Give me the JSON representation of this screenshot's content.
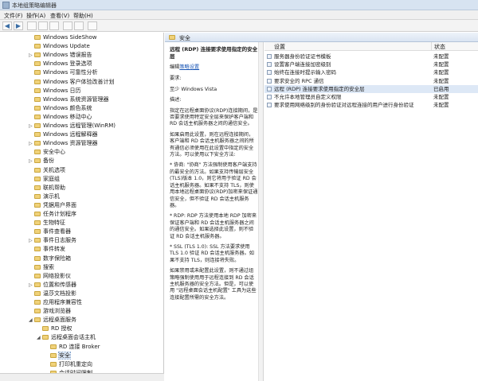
{
  "window": {
    "title": "本地组策略编辑器"
  },
  "menu": [
    "文件(F)",
    "操作(A)",
    "查看(V)",
    "帮助(H)"
  ],
  "toolbar": {
    "back_glyph": "◀",
    "forward_glyph": "▶",
    "buttons": [
      "folder-up-icon",
      "show-hide-tree-icon",
      "export-icon",
      "help-icon",
      "properties-icon",
      "filter-icon"
    ]
  },
  "tree": {
    "items": [
      {
        "label": "Windows SideShow",
        "indent": 3,
        "icon": "folder"
      },
      {
        "label": "Windows Update",
        "indent": 3,
        "icon": "folder"
      },
      {
        "label": "Windows 错误报告",
        "indent": 3,
        "icon": "folder",
        "expander": "▷"
      },
      {
        "label": "Windows 登录选项",
        "indent": 3,
        "icon": "folder"
      },
      {
        "label": "Windows 可靠性分析",
        "indent": 3,
        "icon": "folder"
      },
      {
        "label": "Windows 客户体验改善计划",
        "indent": 3,
        "icon": "folder"
      },
      {
        "label": "Windows 日历",
        "indent": 3,
        "icon": "folder"
      },
      {
        "label": "Windows 系统资源管理器",
        "indent": 3,
        "icon": "folder"
      },
      {
        "label": "Windows 颜色系统",
        "indent": 3,
        "icon": "folder"
      },
      {
        "label": "Windows 移动中心",
        "indent": 3,
        "icon": "folder"
      },
      {
        "label": "Windows 远程管理(WinRM)",
        "indent": 3,
        "icon": "folder",
        "expander": "▷"
      },
      {
        "label": "Windows 远程解释器",
        "indent": 3,
        "icon": "folder"
      },
      {
        "label": "Windows 资源管理器",
        "indent": 3,
        "icon": "folder",
        "expander": "▷"
      },
      {
        "label": "安全中心",
        "indent": 3,
        "icon": "folder"
      },
      {
        "label": "备份",
        "indent": 3,
        "icon": "folder",
        "expander": "▷"
      },
      {
        "label": "关机选项",
        "indent": 3,
        "icon": "folder"
      },
      {
        "label": "家庭组",
        "indent": 3,
        "icon": "folder"
      },
      {
        "label": "联机帮助",
        "indent": 3,
        "icon": "folder"
      },
      {
        "label": "演示机",
        "indent": 3,
        "icon": "folder"
      },
      {
        "label": "凭据用户界面",
        "indent": 3,
        "icon": "folder"
      },
      {
        "label": "任务计划程序",
        "indent": 3,
        "icon": "folder"
      },
      {
        "label": "生物特征",
        "indent": 3,
        "icon": "folder"
      },
      {
        "label": "事件查看器",
        "indent": 3,
        "icon": "folder"
      },
      {
        "label": "事件日志服务",
        "indent": 3,
        "icon": "folder",
        "expander": "▷"
      },
      {
        "label": "事件转发",
        "indent": 3,
        "icon": "folder"
      },
      {
        "label": "数字保险箱",
        "indent": 3,
        "icon": "folder"
      },
      {
        "label": "搜索",
        "indent": 3,
        "icon": "folder"
      },
      {
        "label": "网络投影仪",
        "indent": 3,
        "icon": "folder"
      },
      {
        "label": "位置和传感器",
        "indent": 3,
        "icon": "folder",
        "expander": "▷"
      },
      {
        "label": "温莎文档投影",
        "indent": 3,
        "icon": "folder"
      },
      {
        "label": "应用程序兼容性",
        "indent": 3,
        "icon": "folder"
      },
      {
        "label": "游戏浏览器",
        "indent": 3,
        "icon": "folder"
      },
      {
        "label": "远程桌面服务",
        "indent": 3,
        "icon": "folder",
        "expander": "◢"
      },
      {
        "label": "RD 授权",
        "indent": 4,
        "icon": "folder"
      },
      {
        "label": "远程桌面会话主机",
        "indent": 4,
        "icon": "folder",
        "expander": "◢"
      },
      {
        "label": "RD 连接 Broker",
        "indent": 5,
        "icon": "folder"
      },
      {
        "label": "安全",
        "indent": 5,
        "icon": "folder",
        "selected": true
      },
      {
        "label": "打印机重定向",
        "indent": 5,
        "icon": "folder"
      },
      {
        "label": "会话时间限制",
        "indent": 5,
        "icon": "folder"
      }
    ]
  },
  "content": {
    "breadcrumb": "安全",
    "policy_title": "远程 (RDP) 连接要求使用指定的安全层",
    "edit_prefix": "编辑",
    "edit_link": "策略设置",
    "requirement_label": "要求:",
    "requirement_value": "至少 Windows Vista",
    "description_label": "描述:",
    "description": [
      "指定在远程桌面协议(RDP)连接期间，是否要求使用特定安全层来保护客户端和 RD 会话主机服务器之间的通信安全。",
      "如果启用此设置，则在远程连接期间，客户端和 RD 会话主机服务器之间的所有通信必须使用在此设置中指定的安全方法。可以使用以下安全方法:",
      "* 协商: \"协商\" 方法强制使用客户端支持的最安全的方法。如果支持传输层安全(TLS)版本 1.0，则它将用于验证 RD 会话主机服务器。如果不支持 TLS，则使用本地远程桌面协议(RDP)加密来保证通信安全，但不验证 RD 会话主机服务器。",
      "* RDP: RDP 方法使用本地 RDP 加密来保证客户端和 RD 会话主机服务器之间的通信安全。如果选择此设置，则不验证 RD 会话主机服务器。",
      "* SSL (TLS 1.0): SSL 方法要求使用 TLS 1.0 验证 RD 会话主机服务器。如果不支持 TLS，则连接将失败。",
      "如果禁用或未配置此设置，则不通过组策略强制使用用于远程连接到 RD 会话主机服务器的安全方法。但是，可以使用 \"远程桌面会话主机配置\" 工具为这些连接配置所需的安全方法。"
    ],
    "columns": {
      "setting": "设置",
      "state": "状态"
    },
    "rows": [
      {
        "setting": "服务器身份验证证书模板",
        "state": "未配置"
      },
      {
        "setting": "设置客户端连接加密级别",
        "state": "未配置"
      },
      {
        "setting": "始终在连接时提示输入密码",
        "state": "未配置"
      },
      {
        "setting": "要求安全的 RPC 通信",
        "state": "未配置"
      },
      {
        "setting": "远程 (RDP) 连接要求使用指定的安全层",
        "state": "已启用",
        "selected": true
      },
      {
        "setting": "不允许本地管理员自定义权限",
        "state": "未配置"
      },
      {
        "setting": "要求使用网络级别的身份验证对远程连接的用户进行身份验证",
        "state": "未配置"
      }
    ]
  },
  "colors": {
    "selection": "#dde8f6",
    "folder": "#f0d27a",
    "link": "#1a56b5"
  }
}
